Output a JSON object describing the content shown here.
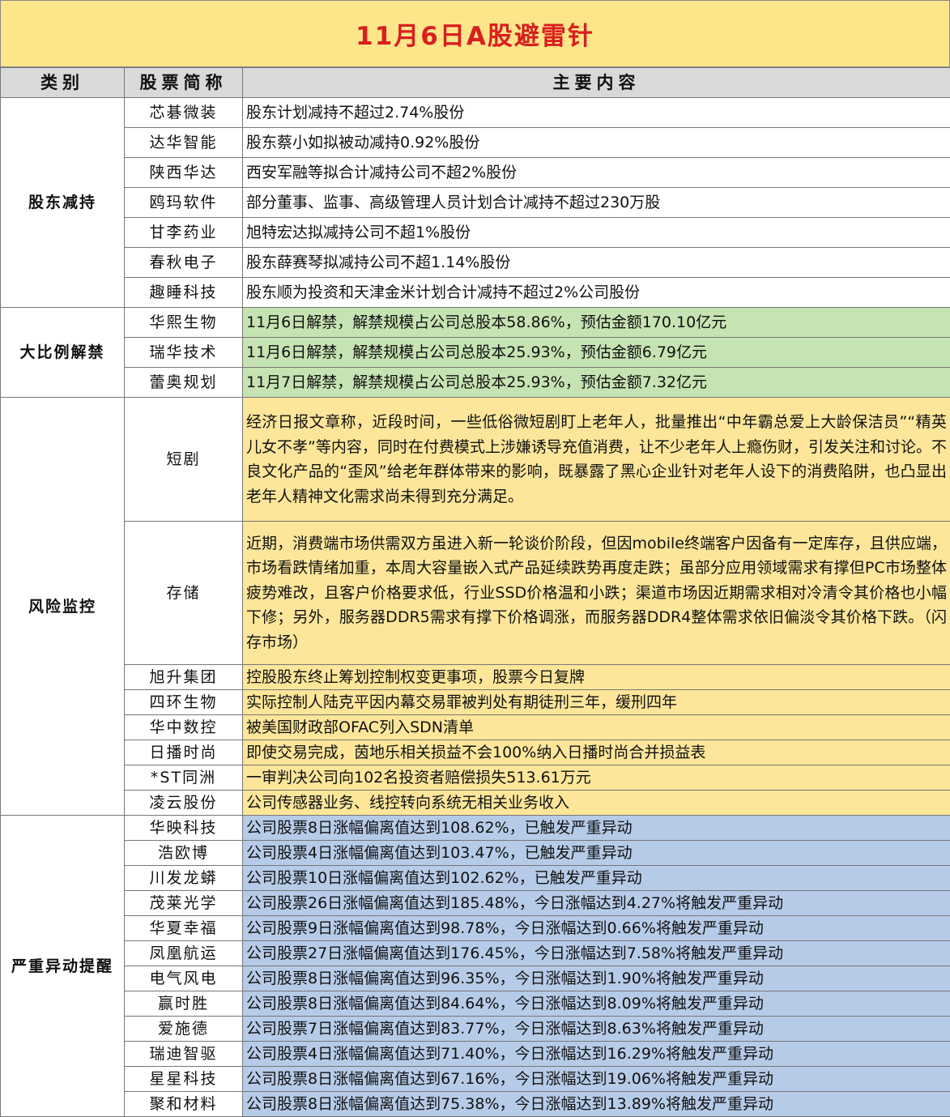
{
  "title": "11月6日A股避雷针",
  "header": {
    "category": "类别",
    "stock": "股票简称",
    "content": "主要内容"
  },
  "sections": [
    {
      "category": "股东减持",
      "rows": [
        {
          "name": "芯碁微装",
          "content": "股东计划减持不超过2.74%股份"
        },
        {
          "name": "达华智能",
          "content": "股东蔡小如拟被动减持0.92%股份"
        },
        {
          "name": "陕西华达",
          "content": "西安军融等拟合计减持公司不超2%股份"
        },
        {
          "name": "鸥玛软件",
          "content": "部分董事、监事、高级管理人员计划合计减持不超过230万股"
        },
        {
          "name": "甘李药业",
          "content": "旭特宏达拟减持公司不超1%股份"
        },
        {
          "name": "春秋电子",
          "content": "股东薛赛琴拟减持公司不超1.14%股份"
        },
        {
          "name": "趣睡科技",
          "content": "股东顺为投资和天津金米计划合计减持不超过2%公司股份"
        }
      ]
    },
    {
      "category": "大比例解禁",
      "rows": [
        {
          "name": "华熙生物",
          "content": "11月6日解禁，解禁规模占公司总股本58.86%，预估金额170.10亿元"
        },
        {
          "name": "瑞华技术",
          "content": "11月6日解禁，解禁规模占公司总股本25.93%，预估金额6.79亿元"
        },
        {
          "name": "蕾奥规划",
          "content": "11月7日解禁，解禁规模占公司总股本25.93%，预估金额7.32亿元"
        }
      ]
    },
    {
      "category": "风险监控",
      "rows": [
        {
          "name": "短剧",
          "content": "经济日报文章称，近段时间，一些低俗微短剧盯上老年人，批量推出“中年霸总爱上大龄保洁员”“精英儿女不孝”等内容，同时在付费模式上涉嫌诱导充值消费，让不少老年人上瘾伤财，引发关注和讨论。不良文化产品的“歪风”给老年群体带来的影响，既暴露了黑心企业针对老年人设下的消费陷阱，也凸显出老年人精神文化需求尚未得到充分满足。"
        },
        {
          "name": "存储",
          "content": "近期，消费端市场供需双方虽进入新一轮谈价阶段，但因mobile终端客户因备有一定库存，且供应端，市场看跌情绪加重，本周大容量嵌入式产品延续跌势再度走跌；虽部分应用领域需求有撑但PC市场整体疲势难改，且客户价格要求低，行业SSD价格温和小跌；渠道市场因近期需求相对冷清令其价格也小幅下修；另外，服务器DDR5需求有撑下价格调涨，而服务器DDR4整体需求依旧偏淡令其价格下跌。（闪存市场）"
        },
        {
          "name": "旭升集团",
          "content": "控股股东终止筹划控制权变更事项，股票今日复牌"
        },
        {
          "name": "四环生物",
          "content": "实际控制人陆克平因内幕交易罪被判处有期徒刑三年，缓刑四年"
        },
        {
          "name": "华中数控",
          "content": "被美国财政部OFAC列入SDN清单"
        },
        {
          "name": "日播时尚",
          "content": "即使交易完成，茵地乐相关损益不会100%纳入日播时尚合并损益表"
        },
        {
          "name": "*ST同洲",
          "content": "一审判决公司向102名投资者赔偿损失513.61万元"
        },
        {
          "name": "凌云股份",
          "content": "公司传感器业务、线控转向系统无相关业务收入"
        }
      ]
    },
    {
      "category": "严重异动提醒",
      "rows": [
        {
          "name": "华映科技",
          "content": "公司股票8日涨幅偏离值达到108.62%，已触发严重异动"
        },
        {
          "name": "浩欧博",
          "content": "公司股票4日涨幅偏离值达到103.47%，已触发严重异动"
        },
        {
          "name": "川发龙蟒",
          "content": "公司股票10日涨幅偏离值达到102.62%，已触发严重异动"
        },
        {
          "name": "茂莱光学",
          "content": "公司股票26日涨幅偏离值达到185.48%，今日涨幅达到4.27%将触发严重异动"
        },
        {
          "name": "华夏幸福",
          "content": "公司股票9日涨幅偏离值达到98.78%，今日涨幅达到0.66%将触发严重异动"
        },
        {
          "name": "凤凰航运",
          "content": "公司股票27日涨幅偏离值达到176.45%，今日涨幅达到7.58%将触发严重异动"
        },
        {
          "name": "电气风电",
          "content": "公司股票8日涨幅偏离值达到96.35%，今日涨幅达到1.90%将触发严重异动"
        },
        {
          "name": "赢时胜",
          "content": "公司股票8日涨幅偏离值达到84.64%，今日涨幅达到8.09%将触发严重异动"
        },
        {
          "name": "爱施德",
          "content": "公司股票7日涨幅偏离值达到83.77%，今日涨幅达到8.63%将触发严重异动"
        },
        {
          "name": "瑞迪智驱",
          "content": "公司股票4日涨幅偏离值达到71.40%，今日涨幅达到16.29%将触发严重异动"
        },
        {
          "name": "星星科技",
          "content": "公司股票8日涨幅偏离值达到67.16%，今日涨幅达到19.06%将触发严重异动"
        },
        {
          "name": "聚和材料",
          "content": "公司股票8日涨幅偏离值达到75.38%，今日涨幅达到13.89%将触发严重异动"
        }
      ]
    }
  ],
  "colors": {
    "title_bg": "#fde68a",
    "title_text": "#d91f1f",
    "header_bg": "#d9d9d9",
    "category_text": "#d91f1f",
    "unlock_bg": "#c6e3b3",
    "risk_bg": "#fde69a",
    "abnormal_bg": "#b6cbe7"
  }
}
